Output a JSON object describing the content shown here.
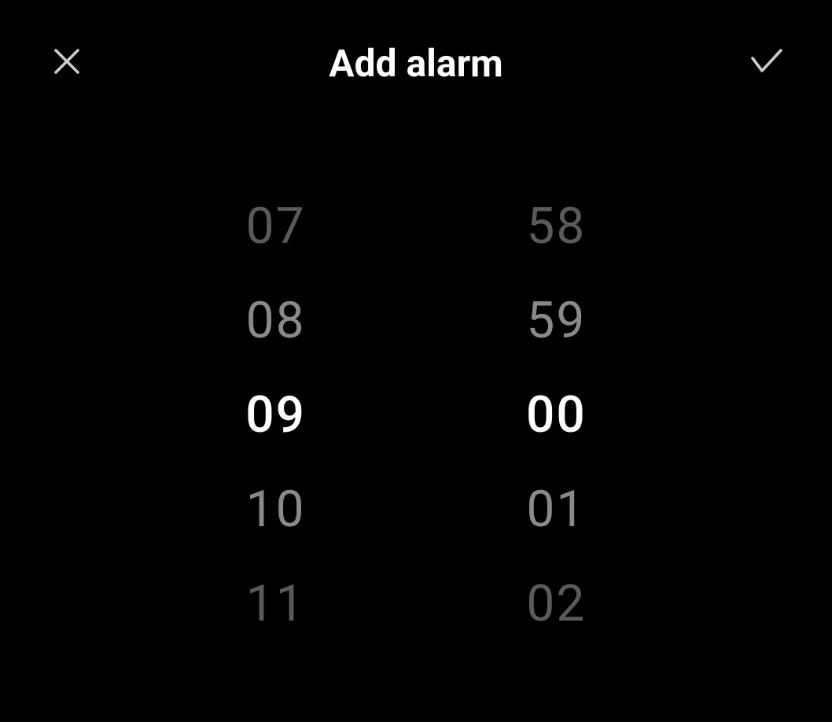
{
  "header": {
    "title": "Add alarm"
  },
  "timePicker": {
    "hours": {
      "items": [
        "07",
        "08",
        "09",
        "10",
        "11"
      ],
      "selectedIndex": 2
    },
    "minutes": {
      "items": [
        "58",
        "59",
        "00",
        "01",
        "02"
      ],
      "selectedIndex": 2
    }
  }
}
